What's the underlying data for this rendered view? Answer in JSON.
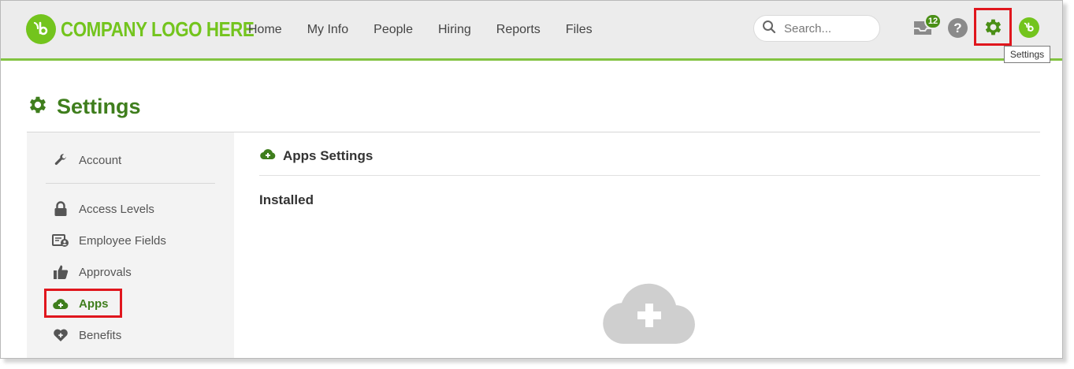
{
  "header": {
    "logo_text": "COMPANY LOGO HERE",
    "nav": [
      "Home",
      "My Info",
      "People",
      "Hiring",
      "Reports",
      "Files"
    ],
    "search_placeholder": "Search...",
    "inbox_count": "12",
    "help_label": "?",
    "settings_tooltip": "Settings"
  },
  "page": {
    "title": "Settings"
  },
  "sidebar": {
    "items": [
      {
        "label": "Account",
        "icon": "wrench-icon"
      },
      {
        "label": "Access Levels",
        "icon": "lock-icon"
      },
      {
        "label": "Employee Fields",
        "icon": "id-card-icon"
      },
      {
        "label": "Approvals",
        "icon": "thumbs-up-icon"
      },
      {
        "label": "Apps",
        "icon": "cloud-plus-icon",
        "active": true
      },
      {
        "label": "Benefits",
        "icon": "heart-plus-icon"
      }
    ]
  },
  "main": {
    "section_title": "Apps Settings",
    "subheading": "Installed"
  },
  "colors": {
    "brand_green": "#73c41d",
    "dark_green": "#3f7e1d",
    "highlight_red": "#e0161d"
  }
}
